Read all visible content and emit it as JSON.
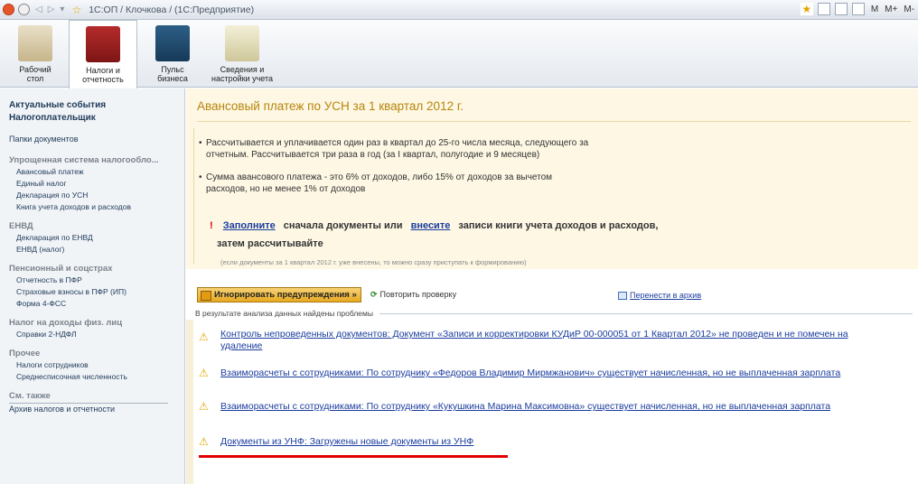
{
  "window": {
    "title": "1С:ОП / Клочкова / (1С:Предприятие)",
    "right_labels": [
      "M",
      "M+",
      "M-"
    ]
  },
  "sections": [
    {
      "label_line1": "Рабочий",
      "label_line2": "стол",
      "icon": "desk-icon"
    },
    {
      "label_line1": "Налоги и",
      "label_line2": "отчетность",
      "icon": "tax-book-icon"
    },
    {
      "label_line1": "Пульс",
      "label_line2": "бизнеса",
      "icon": "pulse-monitor-icon"
    },
    {
      "label_line1": "Сведения и",
      "label_line2": "настройки учета",
      "icon": "clipboard-icon"
    }
  ],
  "sidebar": {
    "top": [
      "Актуальные события",
      "Налогоплательщик"
    ],
    "folders": "Папки документов",
    "groups": [
      {
        "title": "Упрощенная система налогообло...",
        "items": [
          "Авансовый платеж",
          "Единый налог",
          "Декларация по УСН",
          "Книга учета доходов и расходов"
        ]
      },
      {
        "title": "ЕНВД",
        "items": [
          "Декларация по ЕНВД",
          "ЕНВД (налог)"
        ]
      },
      {
        "title": "Пенсионный и соцстрах",
        "items": [
          "Отчетность в ПФР",
          "Страховые взносы в ПФР (ИП)",
          "Форма 4-ФСС"
        ]
      },
      {
        "title": "Налог на доходы физ. лиц",
        "items": [
          "Справки 2-НДФЛ"
        ]
      },
      {
        "title": "Прочее",
        "items": [
          "Налоги сотрудников",
          "Среднесписочная численность"
        ]
      }
    ],
    "see_also": "См. также",
    "see_also_items": [
      "Архив налогов и отчетности"
    ]
  },
  "main": {
    "title": "Авансовый платеж по УСН за 1 квартал 2012 г.",
    "bullet1_line1": "Рассчитывается и уплачивается один раз в квартал до 25-го числа месяца, следующего за",
    "bullet1_line2": "отчетным. Рассчитывается три раза в год (за I квартал, полугодие и 9 месяцев)",
    "bullet2_line1": "Сумма авансового платежа - это 6% от доходов, либо 15% от доходов за вычетом",
    "bullet2_line2": "расходов, но не менее 1% от доходов",
    "warn_link1": "Заполните",
    "warn_text1": "сначала документы или",
    "warn_link2": "внесите",
    "warn_text2": "записи книги учета доходов и расходов,",
    "warn_line2": "затем рассчитывайте",
    "note": "(если документы за 1 квартал 2012 г. уже внесены, то можно сразу приступать к формированию)",
    "ignore_button": "Игнорировать предупреждения »",
    "recheck": "Повторить проверку",
    "archive": "Перенести в архив",
    "problems_caption": "В результате анализа данных найдены проблемы",
    "problems": [
      {
        "line1": "Контроль непроведенных документов: Документ «Записи и корректировки КУДиР 00-000051 от 1 Квартал 2012» не проведен и не помечен на",
        "line2": "удаление"
      },
      {
        "line1": "Взаиморасчеты с сотрудниками: По сотруднику «Федоров Владимир Мирмжанович» существует начисленная, но не выплаченная зарплата",
        "line2": ""
      },
      {
        "line1": "Взаиморасчеты с сотрудниками: По сотруднику «Кукушкина Марина Максимовна» существует начисленная, но не выплаченная зарплата",
        "line2": ""
      },
      {
        "line1": "Документы из УНФ: Загружены новые документы из УНФ",
        "line2": ""
      }
    ]
  },
  "colors": {
    "title": "#b7860b",
    "link": "#1a3c9e",
    "highlight": "#e00000",
    "banner": "#fdf7e4"
  }
}
